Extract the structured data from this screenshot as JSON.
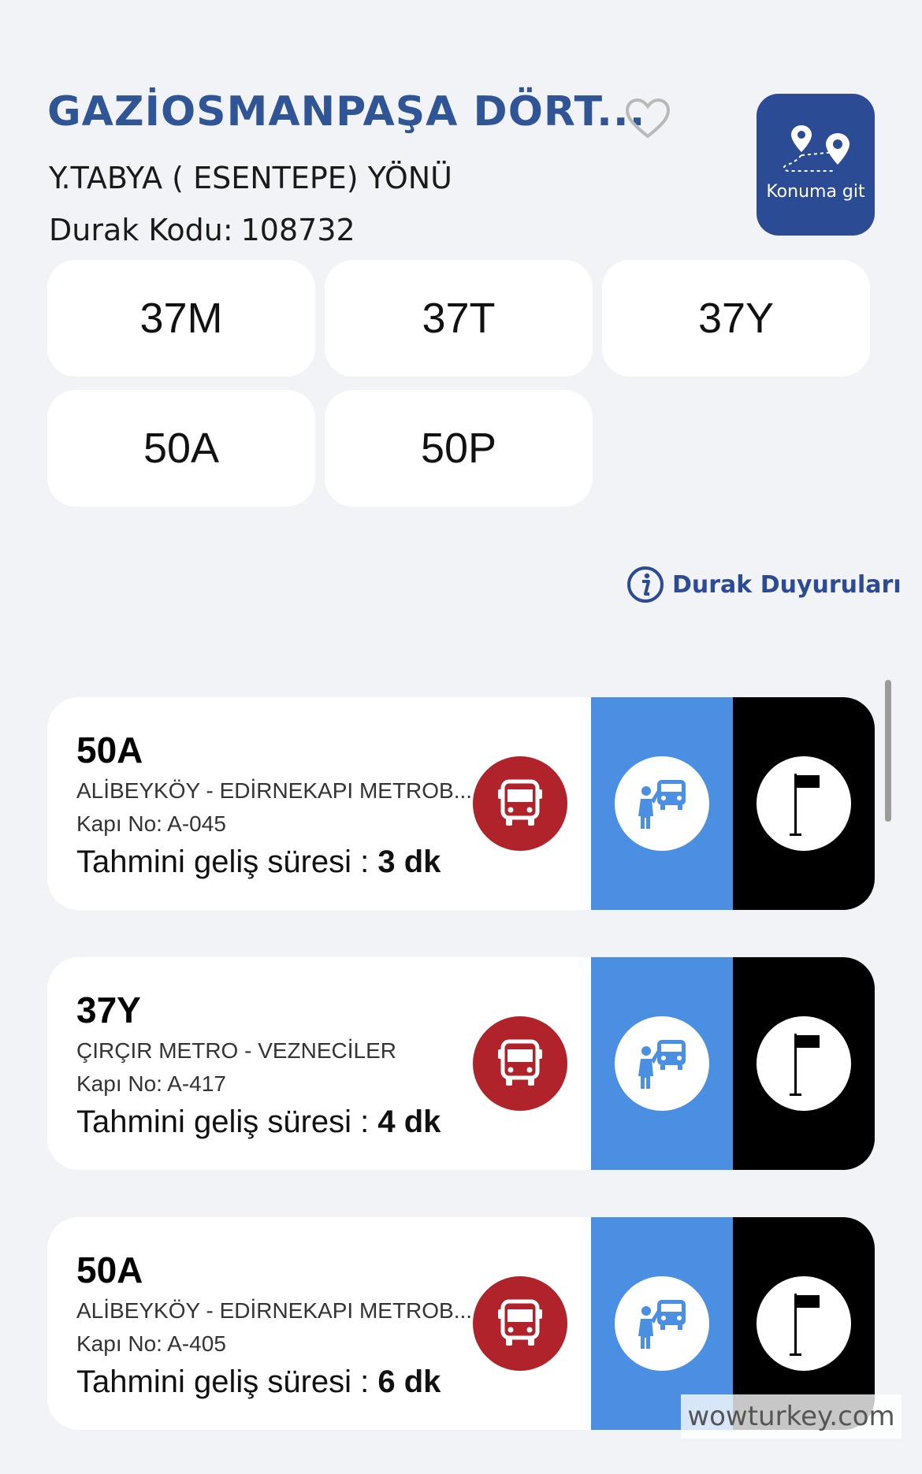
{
  "header": {
    "title": "GAZİOSMANPAŞA DÖRT...",
    "direction": "Y.TABYA ( ESENTEPE) YÖNÜ",
    "stop_code_label": "Durak Kodu:",
    "stop_code_value": "108732",
    "favorite_icon": "heart-outline-icon",
    "location_button_label": "Konuma git",
    "location_icon": "route-map-pin-icon"
  },
  "lines": [
    "37M",
    "37T",
    "37Y",
    "50A",
    "50P"
  ],
  "announcements_label": "Durak Duyuruları",
  "arrivals": [
    {
      "line": "50A",
      "route": "ALİBEYKÖY - EDİRNEKAPI METROB...",
      "door": "Kapı No: A-045",
      "eta_label": "Tahmini geliş süresi :",
      "eta_value": "3 dk"
    },
    {
      "line": "37Y",
      "route": "ÇIRÇIR METRO - VEZNECİLER",
      "door": "Kapı No: A-417",
      "eta_label": "Tahmini geliş süresi :",
      "eta_value": "4 dk"
    },
    {
      "line": "50A",
      "route": "ALİBEYKÖY - EDİRNEKAPI METROB...",
      "door": "Kapı No: A-405",
      "eta_label": "Tahmini geliş süresi :",
      "eta_value": "6 dk"
    }
  ],
  "colors": {
    "brand_blue": "#2f5596",
    "bus_red": "#b0232a",
    "stop_blue": "#4b8fe2",
    "background": "#f2f3f7"
  },
  "watermark": "wowturkey.com"
}
